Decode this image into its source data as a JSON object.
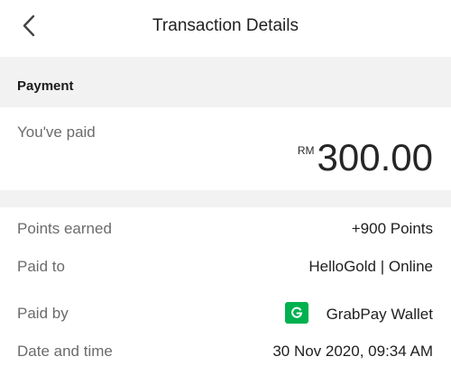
{
  "header": {
    "title": "Transaction Details"
  },
  "payment_section": {
    "title": "Payment",
    "paid_label": "You've paid",
    "currency": "RM",
    "amount": "300.00"
  },
  "details": {
    "rows": [
      {
        "label": "Points earned",
        "value": "+900 Points"
      },
      {
        "label": "Paid to",
        "value": "HelloGold | Online"
      },
      {
        "label": "Paid by",
        "value": "GrabPay Wallet",
        "icon": "grabpay-icon"
      },
      {
        "label": "Date and time",
        "value": "30 Nov 2020, 09:34 AM"
      }
    ]
  },
  "colors": {
    "section_background": "#f2f2f2",
    "grabpay_green": "#00b14f"
  }
}
